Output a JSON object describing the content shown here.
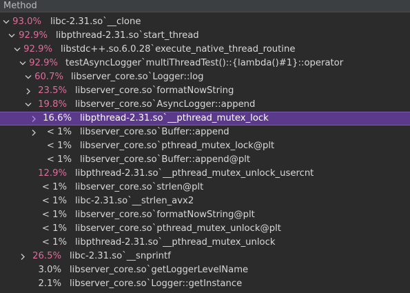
{
  "header": {
    "title": "Method"
  },
  "rows": [
    {
      "id": "r0",
      "expander": "expanded",
      "pct": "93.0%",
      "hot": true,
      "name": "libc-2.31.so`__clone"
    },
    {
      "id": "r1",
      "expander": "expanded",
      "pct": "92.9%",
      "hot": true,
      "name": "libpthread-2.31.so`start_thread"
    },
    {
      "id": "r2",
      "expander": "expanded",
      "pct": "92.9%",
      "hot": true,
      "name": "libstdc++.so.6.0.28`execute_native_thread_routine"
    },
    {
      "id": "r3",
      "expander": "expanded",
      "pct": "92.9%",
      "hot": true,
      "name": "testAsyncLogger`multiThreadTest()::{lambda()#1}::operator"
    },
    {
      "id": "r4",
      "expander": "expanded",
      "pct": "60.7%",
      "hot": true,
      "name": "libserver_core.so`Logger::log"
    },
    {
      "id": "r5",
      "expander": "collapsed",
      "pct": "23.5%",
      "hot": true,
      "name": "libserver_core.so`formatNowString"
    },
    {
      "id": "r6",
      "expander": "expanded",
      "pct": "19.8%",
      "hot": true,
      "name": "libserver_core.so`AsyncLogger::append"
    },
    {
      "id": "r7",
      "expander": "collapsed",
      "pct": "16.6%",
      "hot": true,
      "name": "libpthread-2.31.so`__pthread_mutex_lock",
      "selected": true
    },
    {
      "id": "r8",
      "expander": "collapsed",
      "pct": "< 1%",
      "hot": false,
      "name": "libserver_core.so`Buffer::append"
    },
    {
      "id": "r9",
      "expander": "none",
      "pct": "< 1%",
      "hot": false,
      "name": "libserver_core.so`pthread_mutex_lock@plt"
    },
    {
      "id": "r10",
      "expander": "none",
      "pct": "< 1%",
      "hot": false,
      "name": "libserver_core.so`Buffer::append@plt"
    },
    {
      "id": "r11",
      "expander": "none",
      "pct": "12.9%",
      "hot": true,
      "name": "libpthread-2.31.so`__pthread_mutex_unlock_usercnt"
    },
    {
      "id": "r12",
      "expander": "none",
      "pct": "< 1%",
      "hot": false,
      "name": "libserver_core.so`strlen@plt"
    },
    {
      "id": "r13",
      "expander": "none",
      "pct": "< 1%",
      "hot": false,
      "name": "libc-2.31.so`__strlen_avx2"
    },
    {
      "id": "r14",
      "expander": "none",
      "pct": "< 1%",
      "hot": false,
      "name": "libserver_core.so`formatNowString@plt"
    },
    {
      "id": "r15",
      "expander": "none",
      "pct": "< 1%",
      "hot": false,
      "name": "libserver_core.so`pthread_mutex_unlock@plt"
    },
    {
      "id": "r16",
      "expander": "none",
      "pct": "< 1%",
      "hot": false,
      "name": "libpthread-2.31.so`__pthread_mutex_unlock"
    },
    {
      "id": "r17",
      "expander": "collapsed",
      "pct": "26.5%",
      "hot": true,
      "name": "libc-2.31.so`__snprintf"
    },
    {
      "id": "r18",
      "expander": "none",
      "pct": "3.0%",
      "hot": false,
      "name": "libserver_core.so`getLoggerLevelName"
    },
    {
      "id": "r19",
      "expander": "none",
      "pct": "2.1%",
      "hot": false,
      "name": "libserver_core.so`Logger::getInstance"
    }
  ],
  "colors": {
    "background": "#2b2b2b",
    "hot_percent": "#e06c9b",
    "selection": "#5b3a8c"
  }
}
